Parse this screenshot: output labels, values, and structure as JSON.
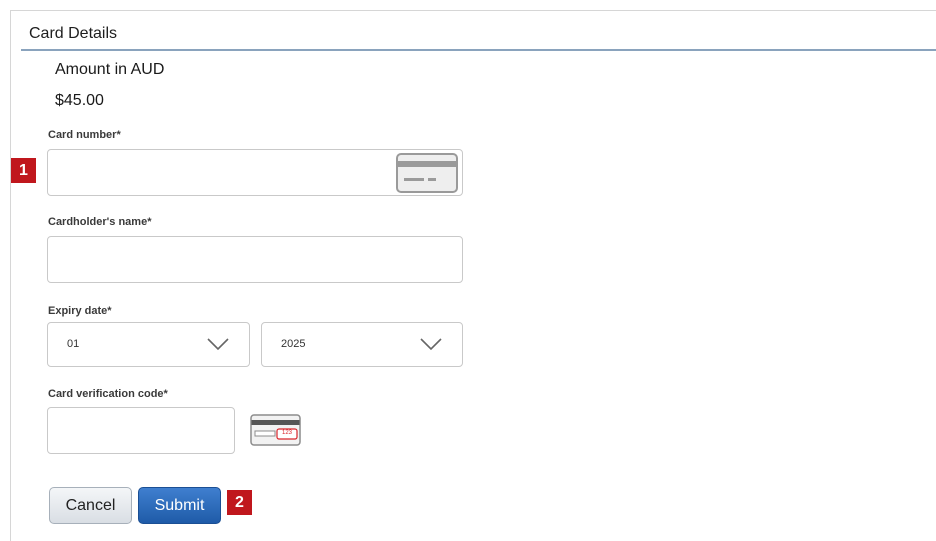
{
  "header": {
    "title": "Card Details"
  },
  "amount": {
    "label": "Amount in AUD",
    "value": "$45.00"
  },
  "card_number": {
    "label": "Card number*",
    "value": "",
    "icon": "credit-card-icon"
  },
  "cardholder": {
    "label": "Cardholder's name*",
    "value": ""
  },
  "expiry": {
    "label": "Expiry date*",
    "month": "01",
    "year": "2025",
    "icon": "chevron-down-icon"
  },
  "cvc": {
    "label": "Card verification code*",
    "value": "",
    "icon_text": "123",
    "icon": "card-cvc-icon"
  },
  "buttons": {
    "cancel": "Cancel",
    "submit": "Submit"
  },
  "markers": {
    "one": "1",
    "two": "2"
  },
  "colors": {
    "marker": "#c0171d",
    "submit": "#2a6bbf",
    "header_rule": "#8aa3bd"
  }
}
